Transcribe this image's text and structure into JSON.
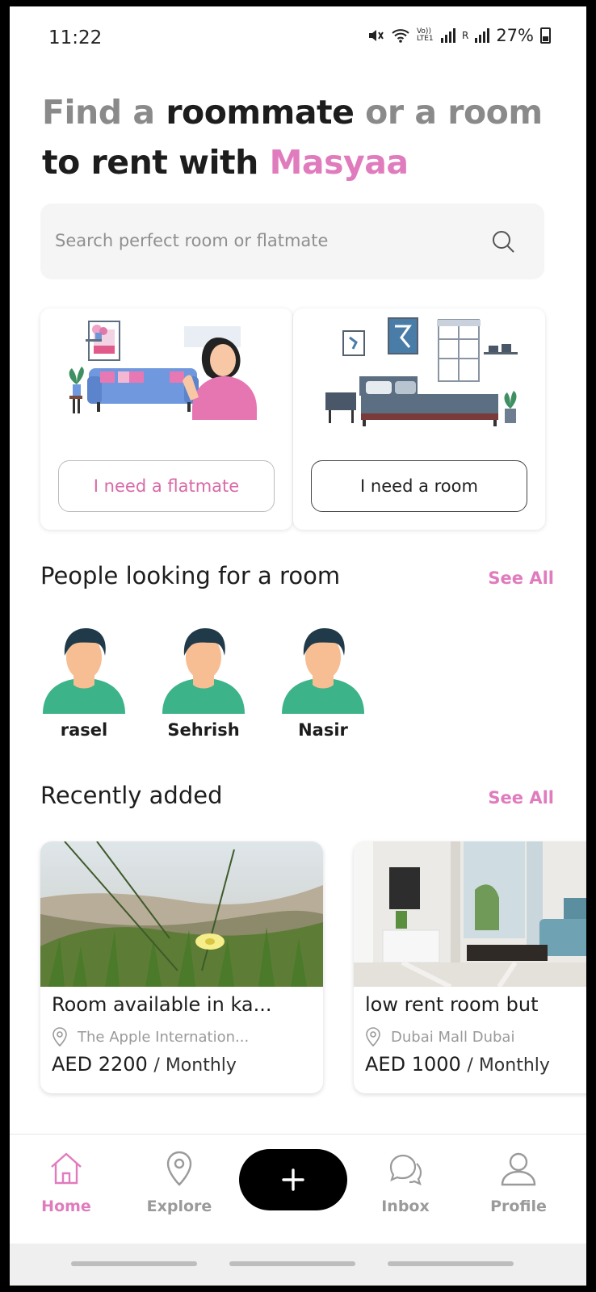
{
  "status_bar": {
    "time": "11:22",
    "network_label": "Vo)) LTE1",
    "sim_label": "R",
    "battery": "27%"
  },
  "hero": {
    "part1": "Find a ",
    "part2": "roommate",
    "part3": " or a room",
    "part4": "to rent with ",
    "brand": "Masyaa"
  },
  "search": {
    "placeholder": "Search perfect room or flatmate",
    "icon": "search-icon"
  },
  "options": [
    {
      "label": "I need a flatmate",
      "icon": "person-sofa-illustration"
    },
    {
      "label": "I need a room",
      "icon": "bedroom-illustration"
    }
  ],
  "people_section": {
    "title": "People looking for a room",
    "see_all": "See All",
    "people": [
      {
        "name": "rasel"
      },
      {
        "name": "Sehrish"
      },
      {
        "name": "Nasir"
      }
    ]
  },
  "recent_section": {
    "title": "Recently added",
    "see_all": "See All",
    "listings": [
      {
        "title": "Room available in ka...",
        "location": "The Apple Internation...",
        "price": "AED 2200",
        "period": "/ Monthly"
      },
      {
        "title": "low rent room but",
        "location": "Dubai Mall  Dubai",
        "price": "AED 1000",
        "period": "/ Monthly"
      }
    ]
  },
  "nav": {
    "items": [
      {
        "label": "Home",
        "icon": "home-icon",
        "active": true
      },
      {
        "label": "Explore",
        "icon": "location-pin-icon",
        "active": false
      },
      {
        "label": "Inbox",
        "icon": "chat-bubbles-icon",
        "active": false
      },
      {
        "label": "Profile",
        "icon": "user-icon",
        "active": false
      }
    ],
    "add_icon": "plus-icon"
  },
  "colors": {
    "brand_pink": "#e07bbd",
    "text_dark": "#1d1d1d",
    "text_grey": "#8a8a8a"
  }
}
